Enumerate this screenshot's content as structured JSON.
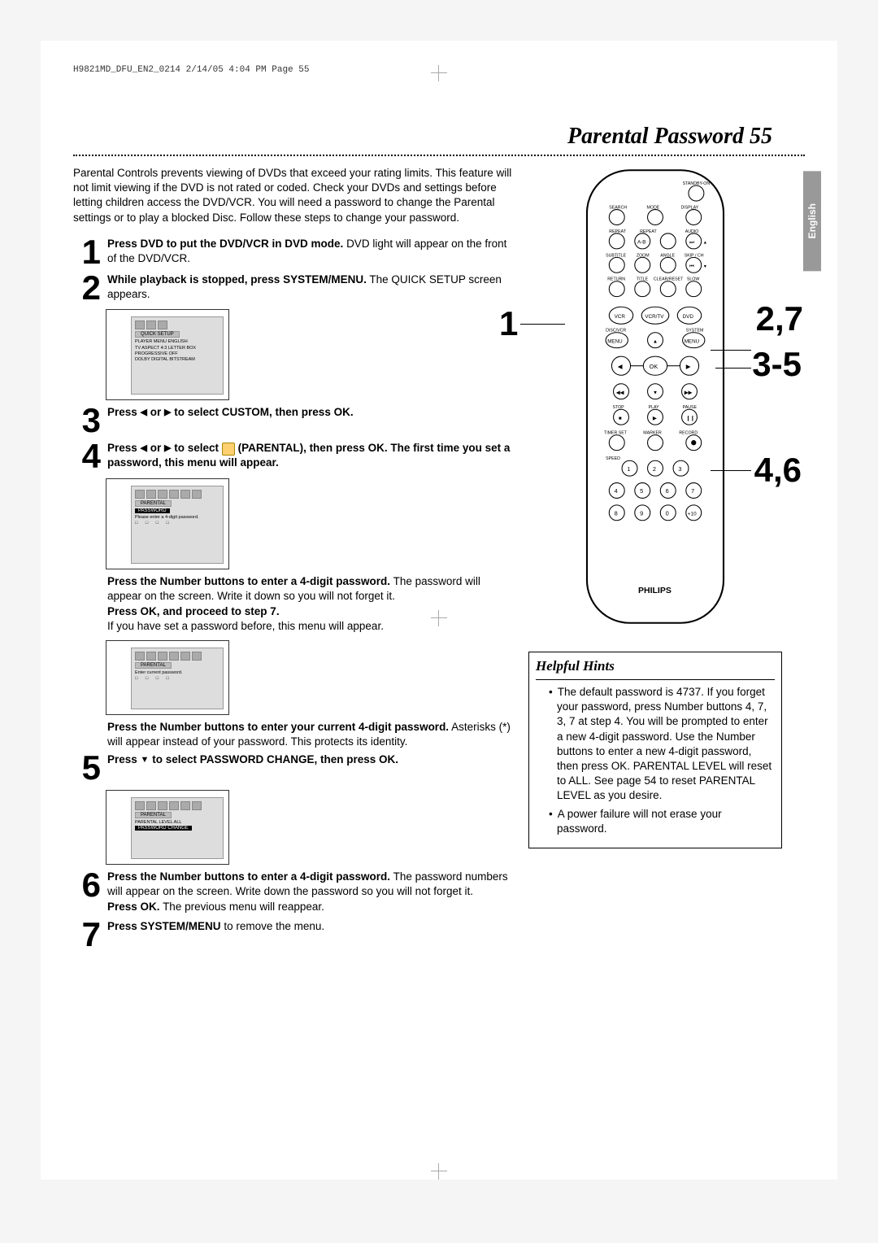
{
  "print_header": "H9821MD_DFU_EN2_0214  2/14/05  4:04 PM  Page 55",
  "page_title_text": "Parental Password",
  "page_title_num": "55",
  "language_tab": "English",
  "intro": "Parental Controls prevents viewing of DVDs that exceed your rating limits. This feature will not limit viewing if the DVD is not rated or coded. Check your DVDs and settings before letting children access the DVD/VCR. You will need a password to change the Parental settings or to play a blocked Disc. Follow these steps to change your password.",
  "steps": {
    "s1": {
      "num": "1",
      "bold": "Press DVD to put the DVD/VCR in DVD mode.",
      "rest": " DVD light will appear on the front of the DVD/VCR."
    },
    "s2": {
      "num": "2",
      "bold": "While playback is stopped, press SYSTEM/MENU.",
      "rest": " The QUICK SETUP screen appears."
    },
    "s3": {
      "num": "3",
      "pre": "Press ",
      "mid": " or ",
      "post": " to select CUSTOM, then press OK."
    },
    "s4": {
      "num": "4",
      "pre": "Press ",
      "mid1": " or ",
      "mid2": " to select ",
      "post": " (PARENTAL), then press OK. The first time you set a password, this menu will appear."
    },
    "s4b": {
      "bold1": "Press the Number buttons to enter a 4-digit password.",
      "rest1": " The password will appear on the screen. Write it down so you will not forget it.",
      "bold2": "Press OK, and proceed to step 7.",
      "rest2": "If you have set a password before, this menu will appear."
    },
    "s4c": {
      "bold": "Press the Number buttons to enter your current 4-digit password.",
      "rest": " Asterisks (*) will appear instead of your password. This protects its identity."
    },
    "s5": {
      "num": "5",
      "pre": "Press ",
      "post": " to select PASSWORD CHANGE, then press OK."
    },
    "s6": {
      "num": "6",
      "bold1": "Press the Number buttons to enter a 4-digit password.",
      "rest1": " The password numbers will appear on the screen. Write down the password so you will not forget it.",
      "bold2": "Press OK.",
      "rest2": " The previous menu will reappear."
    },
    "s7": {
      "num": "7",
      "bold": "Press SYSTEM/MENU",
      "rest": " to remove the menu."
    }
  },
  "screens": {
    "quick_setup": {
      "tab": "QUICK SETUP",
      "lines": [
        "PLAYER MENU    ENGLISH",
        "TV ASPECT      4:3 LETTER BOX",
        "PROGRESSIVE    OFF",
        "DOLBY DIGITAL  BITSTREAM"
      ]
    },
    "parental_new": {
      "tab": "PARENTAL",
      "hl": "PASSWORD",
      "line": "Please enter a 4-digit password.",
      "dots": "□ □ □ □"
    },
    "parental_cur": {
      "tab": "PARENTAL",
      "line": "Enter current password.",
      "dots": "□ □ □ □"
    },
    "parental_level": {
      "tab": "PARENTAL",
      "line": "PARENTAL LEVEL   ALL",
      "hl": "PASSWORD CHANGE"
    }
  },
  "remote": {
    "labels": {
      "standby": "STANDBY-ON",
      "search": "SEARCH",
      "mode": "MODE",
      "display": "DISPLAY",
      "repeat": "REPEAT",
      "ab": "A-B",
      "audio": "AUDIO",
      "subtitle": "SUBTITLE",
      "zoom": "ZOOM",
      "angle": "ANGLE",
      "skip": "SKIP / CH",
      "return": "RETURN",
      "title": "TITLE",
      "clear": "CLEAR/RESET",
      "slow": "SLOW",
      "vcr": "VCR",
      "vcrtv": "VCR/TV",
      "dvd": "DVD",
      "discvcr": "DISC/VCR",
      "system": "SYSTEM",
      "menu": "MENU",
      "menu2": "MENU",
      "ok": "OK",
      "stop": "STOP",
      "play": "PLAY",
      "pause": "PAUSE",
      "timerset": "TIMER SET",
      "marker": "MARKER",
      "record": "RECORD",
      "speed": "SPEED",
      "brand": "PHILIPS"
    },
    "nums": [
      "1",
      "2",
      "3",
      "4",
      "5",
      "6",
      "7",
      "8",
      "9",
      "0",
      "+10"
    ]
  },
  "callouts": {
    "c1": "1",
    "c27": "2,7",
    "c35": "3-5",
    "c46": "4,6"
  },
  "hints": {
    "title": "Helpful Hints",
    "item1": "The default password is 4737. If you forget your password, press Number buttons 4, 7, 3, 7 at step 4. You will be prompted to enter a new 4-digit password. Use the Number buttons to enter a new 4-digit password, then press OK. PARENTAL LEVEL will reset to ALL. See page 54 to reset PARENTAL LEVEL as you desire.",
    "item2": "A power failure will not erase your password."
  }
}
